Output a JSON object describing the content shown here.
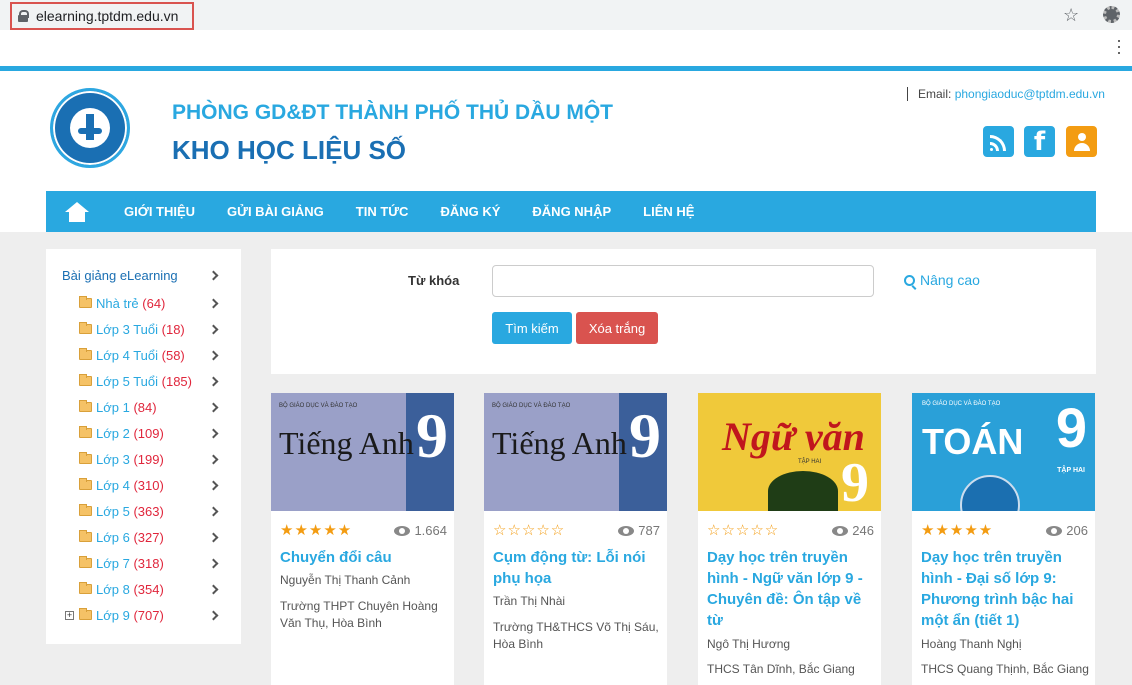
{
  "browser": {
    "url": "elearning.tptdm.edu.vn"
  },
  "header": {
    "subtitle": "PHÒNG GD&ĐT THÀNH PHỐ THỦ DẦU MỘT",
    "title": "KHO HỌC LIỆU SỐ",
    "email_label": "Email:",
    "email": "phongiaoduc@tptdm.edu.vn",
    "facebook_glyph": "f"
  },
  "nav": {
    "items": [
      "GIỚI THIỆU",
      "GỬI BÀI GIẢNG",
      "TIN TỨC",
      "ĐĂNG KÝ",
      "ĐĂNG NHẬP",
      "LIÊN HỆ"
    ]
  },
  "sidebar": {
    "title": "Bài giảng eLearning",
    "items": [
      {
        "label": "Nhà trẻ",
        "count": "(64)"
      },
      {
        "label": "Lớp 3 Tuổi",
        "count": "(18)"
      },
      {
        "label": "Lớp 4 Tuổi",
        "count": "(58)"
      },
      {
        "label": "Lớp 5 Tuổi",
        "count": "(185)"
      },
      {
        "label": "Lớp 1",
        "count": "(84)"
      },
      {
        "label": "Lớp 2",
        "count": "(109)"
      },
      {
        "label": "Lớp 3",
        "count": "(199)"
      },
      {
        "label": "Lớp 4",
        "count": "(310)"
      },
      {
        "label": "Lớp 5",
        "count": "(363)"
      },
      {
        "label": "Lớp 6",
        "count": "(327)"
      },
      {
        "label": "Lớp 7",
        "count": "(318)"
      },
      {
        "label": "Lớp 8",
        "count": "(354)"
      },
      {
        "label": "Lớp 9",
        "count": "(707)"
      }
    ],
    "expand_glyph": "+"
  },
  "search": {
    "keyword_label": "Từ khóa",
    "keyword_value": "",
    "advanced_label": "Nâng cao",
    "search_button": "Tìm kiếm",
    "clear_button": "Xóa trắng"
  },
  "cards": [
    {
      "cover": {
        "small": "BỘ GIÁO DỤC VÀ ĐÀO TẠO",
        "title": "Tiếng Anh",
        "number": "9"
      },
      "stars_full": "★★★★★",
      "stars_empty": "",
      "views": "1.664",
      "title": "Chuyển đổi câu",
      "author": "Nguyễn Thị Thanh Cảnh",
      "school": "Trường THPT Chuyên Hoàng Văn Thụ, Hòa Bình"
    },
    {
      "cover": {
        "small": "BỘ GIÁO DỤC VÀ ĐÀO TẠO",
        "title": "Tiếng Anh",
        "number": "9"
      },
      "stars_full": "",
      "stars_empty": "☆☆☆☆☆",
      "views": "787",
      "title": "Cụm động từ: Lỗi nói phụ họa",
      "author": "Trần Thị Nhài",
      "school": "Trường TH&THCS Võ Thị Sáu, Hòa Bình"
    },
    {
      "cover": {
        "small": "TẬP HAI",
        "title": "Ngữ văn",
        "number": "9"
      },
      "stars_full": "",
      "stars_empty": "☆☆☆☆☆",
      "views": "246",
      "title": "Dạy học trên truyền hình - Ngữ văn lớp 9 - Chuyên đề: Ôn tập về từ",
      "author": "Ngô Thị Hương",
      "school": "THCS Tân Dĩnh, Bắc Giang"
    },
    {
      "cover": {
        "small": "BỘ GIÁO DỤC VÀ ĐÀO TẠO",
        "title": "TOÁN",
        "number": "9",
        "tap": "TẬP HAI"
      },
      "stars_full": "★★★★★",
      "stars_empty": "",
      "views": "206",
      "title": "Dạy học trên truyền hình - Đại số lớp 9: Phương trình bậc hai một ẩn (tiết 1)",
      "author": "Hoàng Thanh Nghị",
      "school": "THCS Quang Thịnh, Bắc Giang"
    }
  ]
}
